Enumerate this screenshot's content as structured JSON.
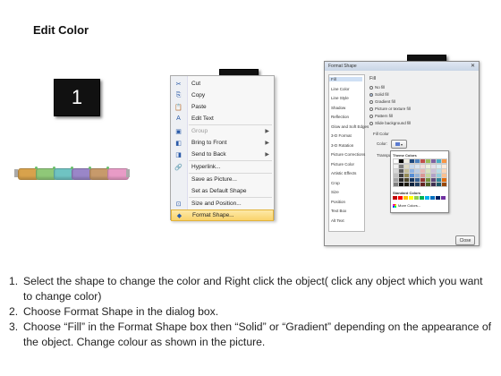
{
  "title": "Edit Color",
  "steps": {
    "s1": "1",
    "s2": "2",
    "s3": "3"
  },
  "chain_colors": [
    "#d8a24c",
    "#8fc878",
    "#6fc3c2",
    "#9a86c8",
    "#c79a6b",
    "#e89bc6"
  ],
  "context_menu": {
    "items": [
      {
        "label": "Cut",
        "icon": "scissors-icon",
        "glyph": "✂",
        "disabled": false
      },
      {
        "label": "Copy",
        "icon": "copy-icon",
        "glyph": "⎘",
        "disabled": false
      },
      {
        "label": "Paste",
        "icon": "paste-icon",
        "glyph": "📋",
        "disabled": false
      },
      {
        "label": "Edit Text",
        "icon": "edit-text-icon",
        "glyph": "A",
        "disabled": false
      },
      {
        "label": "Group",
        "icon": "group-icon",
        "glyph": "▣",
        "disabled": true,
        "submenu": true
      },
      {
        "label": "Bring to Front",
        "icon": "bring-front-icon",
        "glyph": "◧",
        "disabled": false,
        "submenu": true
      },
      {
        "label": "Send to Back",
        "icon": "send-back-icon",
        "glyph": "◨",
        "disabled": false,
        "submenu": true
      },
      {
        "label": "Hyperlink...",
        "icon": "hyperlink-icon",
        "glyph": "🔗",
        "disabled": false
      },
      {
        "label": "Save as Picture...",
        "icon": "",
        "glyph": "",
        "disabled": false
      },
      {
        "label": "Set as Default Shape",
        "icon": "",
        "glyph": "",
        "disabled": false
      },
      {
        "label": "Size and Position...",
        "icon": "size-position-icon",
        "glyph": "⊡",
        "disabled": false
      },
      {
        "label": "Format Shape...",
        "icon": "format-shape-icon",
        "glyph": "◆",
        "disabled": false,
        "highlighted": true
      }
    ]
  },
  "dialog": {
    "title": "Format Shape",
    "close": "✕",
    "nav": [
      "Fill",
      "Line Color",
      "Line Style",
      "Shadow",
      "Reflection",
      "Glow and Soft Edges",
      "3-D Format",
      "3-D Rotation",
      "Picture Corrections",
      "Picture Color",
      "Artistic Effects",
      "Crop",
      "Size",
      "Position",
      "Text Box",
      "Alt Text"
    ],
    "fill_heading": "Fill",
    "fill_options": [
      "No fill",
      "Solid fill",
      "Gradient fill",
      "Picture or texture fill",
      "Pattern fill",
      "Slide background fill"
    ],
    "fill_color_label": "Fill Color",
    "color_label": "Color:",
    "transparency_label": "Transpa",
    "close_button": "Close",
    "theme_colors_label": "Theme Colors",
    "standard_colors_label": "Standard Colors",
    "more_colors_label": "More Colors..."
  },
  "instructions": [
    {
      "num": "1.",
      "text": "Select the shape to change the color and Right click the object( click any object which you want to change color)"
    },
    {
      "num": "2.",
      "text": "Choose Format Shape in the dialog box."
    },
    {
      "num": "3.",
      "text": "Choose “Fill” in the Format Shape box then “Solid” or “Gradient” depending on the appearance of the object. Change colour as shown in the picture."
    }
  ]
}
